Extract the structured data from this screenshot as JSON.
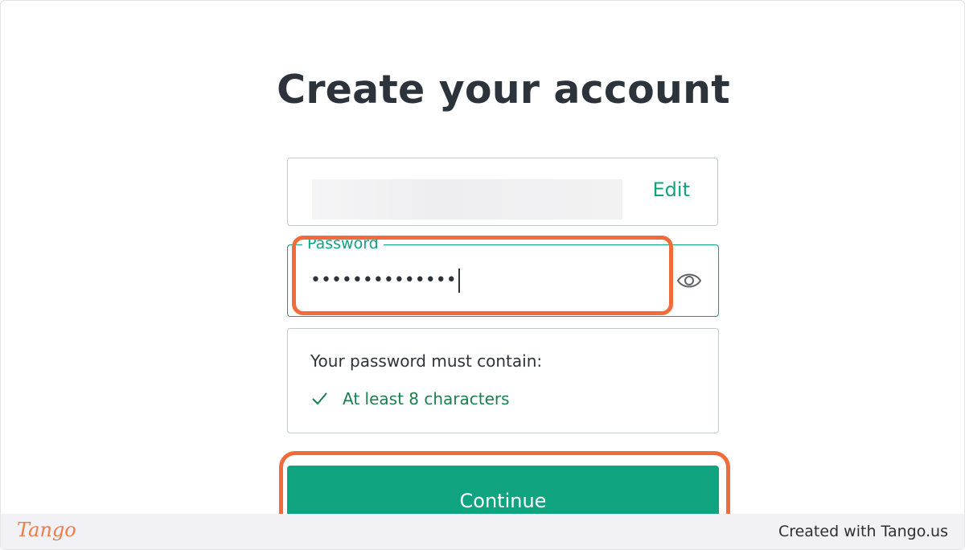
{
  "page": {
    "title": "Create your account"
  },
  "email": {
    "edit_label": "Edit"
  },
  "password": {
    "label": "Password",
    "value": "••••••••••••••"
  },
  "requirements": {
    "heading": "Your password must contain:",
    "items": [
      {
        "label": "At least 8 characters",
        "met": true
      }
    ]
  },
  "actions": {
    "continue_label": "Continue"
  },
  "footer": {
    "logo_text": "Tango",
    "credit": "Created with Tango.us"
  },
  "colors": {
    "accent": "#10a37f",
    "highlight": "#f26b3a",
    "text": "#2d333a"
  },
  "icons": {
    "reveal": "eye-icon",
    "requirement_met": "check-icon"
  }
}
